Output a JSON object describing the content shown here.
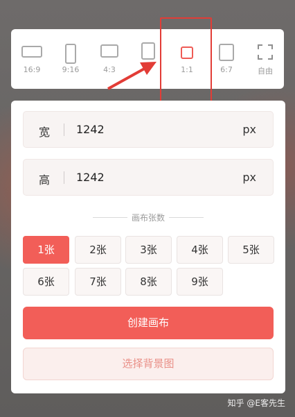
{
  "ratios": [
    {
      "label": "16:9",
      "icon": "rectangle-landscape-icon"
    },
    {
      "label": "9:16",
      "icon": "rectangle-portrait-icon"
    },
    {
      "label": "4:3",
      "icon": "rectangle-landscape-icon"
    },
    {
      "label": "",
      "icon": "rectangle-portrait-icon"
    },
    {
      "label": "1:1",
      "icon": "square-icon",
      "active": true
    },
    {
      "label": "6:7",
      "icon": "rectangle-portrait-icon"
    },
    {
      "label": "自由",
      "icon": "free-crop-icon"
    }
  ],
  "width_field": {
    "label": "宽",
    "value": "1242",
    "unit": "px"
  },
  "height_field": {
    "label": "高",
    "value": "1242",
    "unit": "px"
  },
  "canvas_count": {
    "title": "画布张数",
    "options": [
      "1张",
      "2张",
      "3张",
      "4张",
      "5张",
      "6张",
      "7张",
      "8张",
      "9张"
    ],
    "selected": "1张"
  },
  "buttons": {
    "create": "创建画布",
    "background": "选择背景图"
  },
  "watermark": "知乎 @E客先生",
  "colors": {
    "accent": "#f25e58",
    "highlight": "#e23c36"
  }
}
